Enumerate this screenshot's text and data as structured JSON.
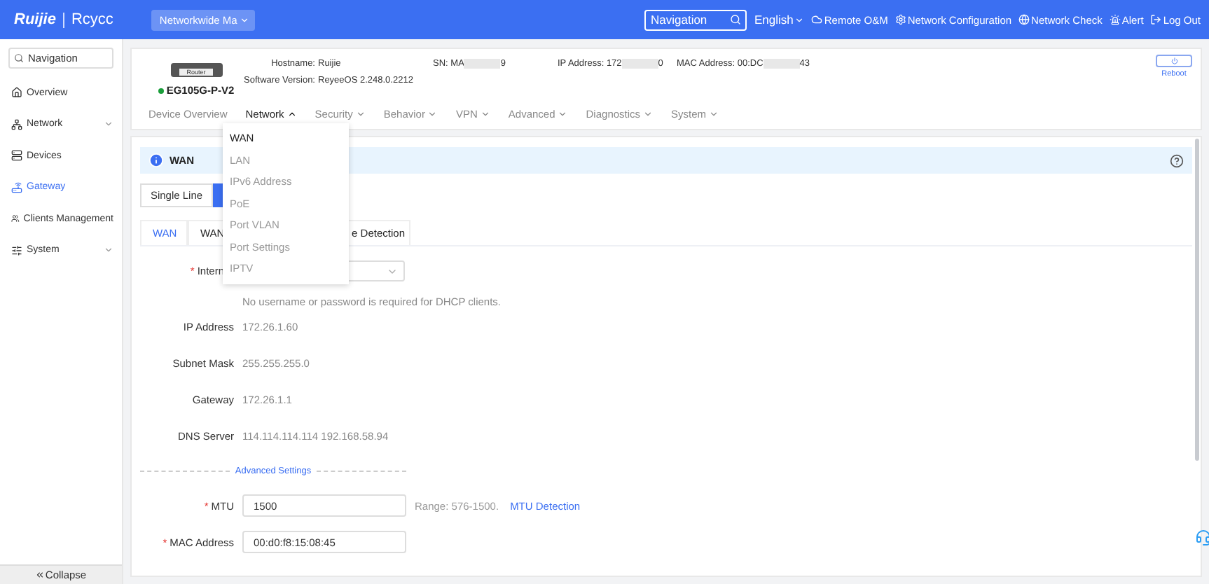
{
  "top_bar": {
    "logo": "Ruijie",
    "product": "Rcycc",
    "project": "Networkwide Ma",
    "search": {
      "placeholder": "Navigation"
    },
    "language": "English",
    "links": [
      {
        "label": "Remote O&M"
      },
      {
        "label": "Network Configuration"
      },
      {
        "label": "Network Check"
      },
      {
        "label": "Alert"
      },
      {
        "label": "Log Out"
      }
    ]
  },
  "sidebar": {
    "search": {
      "placeholder": "Navigation"
    },
    "items": [
      {
        "label": "Overview",
        "selected": false,
        "expandable": false
      },
      {
        "label": "Network",
        "selected": false,
        "expandable": true
      },
      {
        "label": "Devices",
        "selected": false,
        "expandable": false
      },
      {
        "label": "Gateway",
        "selected": true,
        "expandable": false
      },
      {
        "label": "Clients Management",
        "selected": false,
        "expandable": false
      },
      {
        "label": "System",
        "selected": false,
        "expandable": true
      }
    ],
    "collapse": "Collapse"
  },
  "device": {
    "badge": "Router",
    "model": "EG105G-P-V2",
    "online": true,
    "hostname": {
      "label": "Hostname:",
      "value": "Ruijie"
    },
    "software": {
      "label": "Software Version:",
      "value": "ReyeeOS 2.248.0.2212"
    },
    "masked": [
      {
        "label": "SN:",
        "value_start": "MA",
        "value_end": "9"
      },
      {
        "label": "IP Address:",
        "value_start": "172",
        "value_end": "0"
      },
      {
        "label": "MAC Address:",
        "value_start": "00:DC",
        "value_end": "43"
      }
    ],
    "reboot": "Reboot"
  },
  "nav_tabs": [
    {
      "label": "Device Overview",
      "selected": false,
      "dropdown": false
    },
    {
      "label": "Network",
      "selected": true,
      "dropdown": true
    },
    {
      "label": "Security",
      "selected": false,
      "dropdown": true
    },
    {
      "label": "Behavior",
      "selected": false,
      "dropdown": true
    },
    {
      "label": "VPN",
      "selected": false,
      "dropdown": true
    },
    {
      "label": "Advanced",
      "selected": false,
      "dropdown": true
    },
    {
      "label": "Diagnostics",
      "selected": false,
      "dropdown": true
    },
    {
      "label": "System",
      "selected": false,
      "dropdown": true
    }
  ],
  "network_menu": [
    {
      "label": "WAN",
      "selected": true
    },
    {
      "label": "LAN",
      "selected": false
    },
    {
      "label": "IPv6 Address",
      "selected": false
    },
    {
      "label": "PoE",
      "selected": false
    },
    {
      "label": "Port VLAN",
      "selected": false
    },
    {
      "label": "Port Settings",
      "selected": false
    },
    {
      "label": "IPTV",
      "selected": false
    }
  ],
  "panel": {
    "title": "WAN",
    "line_modes": [
      {
        "label": "Single Line",
        "selected": false
      },
      {
        "selected": true
      }
    ],
    "sub_tabs": [
      {
        "label": "WAN",
        "selected": true
      },
      {
        "label": "WAN",
        "selected": false
      },
      {
        "label": "e Detection",
        "selected": false
      }
    ],
    "internet": {
      "label": "Intern",
      "required_mark": "*"
    },
    "dhcp_hint": "No username or password is required for DHCP clients.",
    "rows": [
      {
        "label": "IP Address",
        "value": "172.26.1.60"
      },
      {
        "label": "Subnet Mask",
        "value": "255.255.255.0"
      },
      {
        "label": "Gateway",
        "value": "172.26.1.1"
      },
      {
        "label": "DNS Server",
        "value": "114.114.114.114 192.168.58.94"
      }
    ],
    "advanced": "Advanced Settings",
    "inputs": [
      {
        "label": "MTU",
        "required_mark": "*",
        "value": "1500",
        "hint": "Range: 576-1500.",
        "link": "MTU Detection"
      },
      {
        "label": "MAC Address",
        "required_mark": "*",
        "value": "00:d0:f8:15:08:45"
      }
    ]
  }
}
